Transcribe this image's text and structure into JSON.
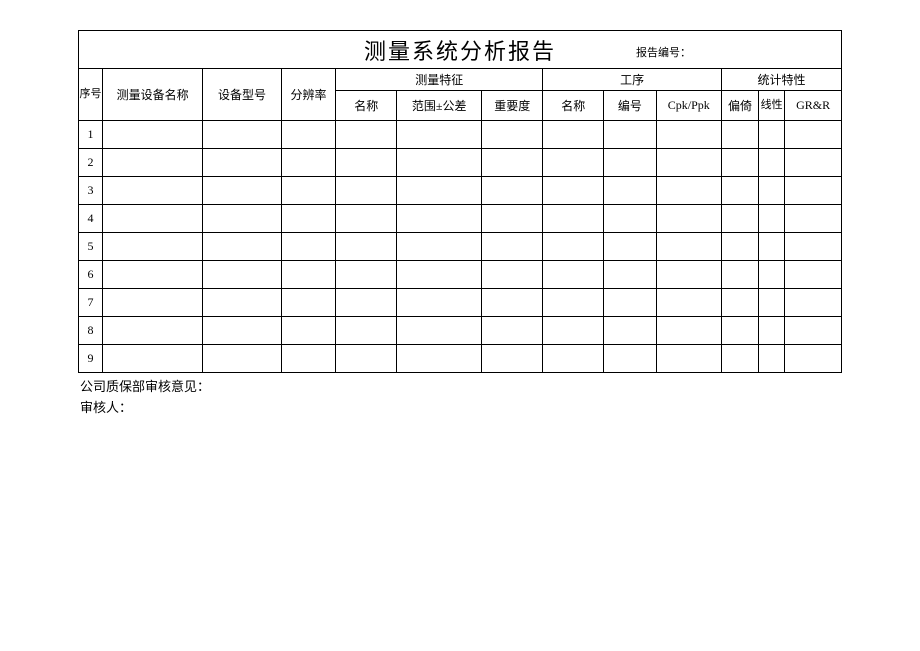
{
  "title": "测量系统分析报告",
  "report_no_label": "报告编号：",
  "headers": {
    "seq": "序号",
    "equip_name": "测量设备名称",
    "equip_model": "设备型号",
    "resolution": "分辨率",
    "char_group": "测量特征",
    "char_name": "名称",
    "char_tolerance": "范围±公差",
    "char_importance": "重要度",
    "proc_group": "工序",
    "proc_name": "名称",
    "proc_no": "编号",
    "cpk": "Cpk/Ppk",
    "stat_group": "统计特性",
    "bias": "偏倚",
    "linearity": "线性",
    "grr": "GR&R"
  },
  "rows": [
    {
      "seq": "1"
    },
    {
      "seq": "2"
    },
    {
      "seq": "3"
    },
    {
      "seq": "4"
    },
    {
      "seq": "5"
    },
    {
      "seq": "6"
    },
    {
      "seq": "7"
    },
    {
      "seq": "8"
    },
    {
      "seq": "9"
    }
  ],
  "footer": {
    "qa_opinion": "公司质保部审核意见：",
    "auditor": "审核人："
  }
}
